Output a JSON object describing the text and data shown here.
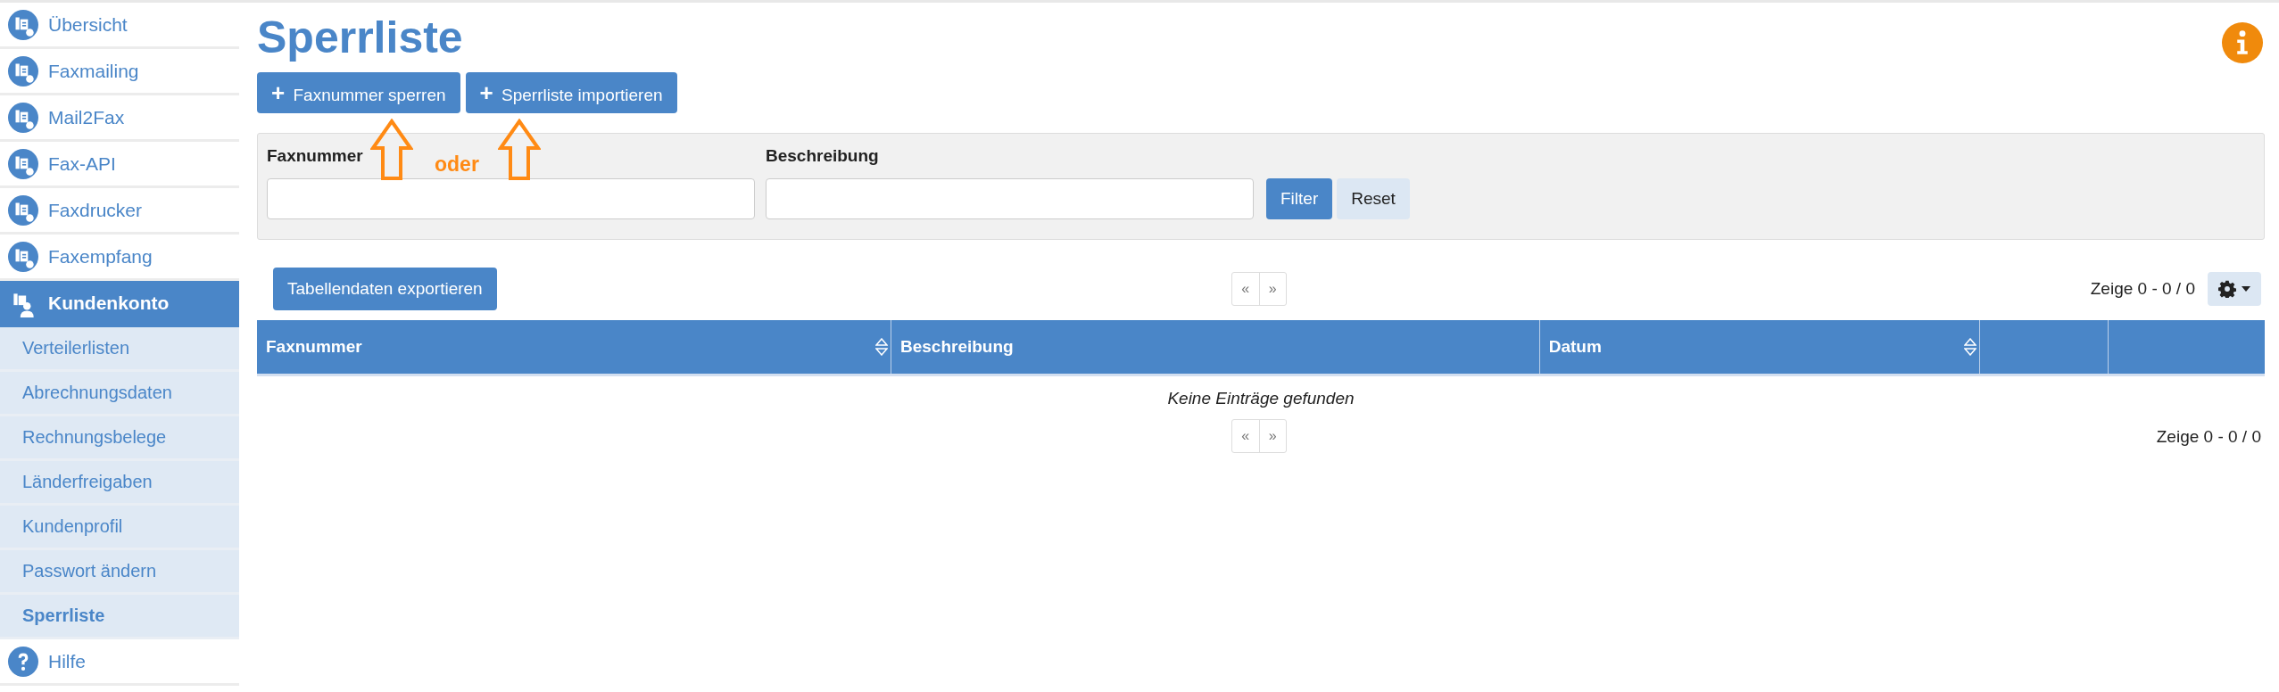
{
  "sidebar": {
    "items": [
      {
        "label": "Übersicht",
        "kind": "fax",
        "selected": false
      },
      {
        "label": "Faxmailing",
        "kind": "fax",
        "selected": false
      },
      {
        "label": "Mail2Fax",
        "kind": "fax",
        "selected": false
      },
      {
        "label": "Fax-API",
        "kind": "fax",
        "selected": false
      },
      {
        "label": "Faxdrucker",
        "kind": "fax",
        "selected": false
      },
      {
        "label": "Faxempfang",
        "kind": "fax",
        "selected": false
      },
      {
        "label": "Kundenkonto",
        "kind": "account",
        "selected": true,
        "expanded": true,
        "children": [
          {
            "label": "Verteilerlisten",
            "selected": false
          },
          {
            "label": "Abrechnungsdaten",
            "selected": false
          },
          {
            "label": "Rechnungsbelege",
            "selected": false
          },
          {
            "label": "Länderfreigaben",
            "selected": false
          },
          {
            "label": "Kundenprofil",
            "selected": false
          },
          {
            "label": "Passwort ändern",
            "selected": false
          },
          {
            "label": "Sperrliste",
            "selected": true
          }
        ]
      },
      {
        "label": "Hilfe",
        "kind": "help",
        "selected": false
      }
    ]
  },
  "page": {
    "title": "Sperrliste",
    "actions": [
      {
        "icon": "+",
        "label": "Faxnummer sperren"
      },
      {
        "icon": "+",
        "label": "Sperrliste importieren"
      }
    ],
    "annotation": {
      "text": "oder"
    },
    "filter": {
      "fields": [
        {
          "label": "Faxnummer"
        },
        {
          "label": "Beschreibung"
        }
      ],
      "buttons": [
        {
          "label": "Filter",
          "kind": "primary"
        },
        {
          "label": "Reset",
          "kind": "secondary"
        }
      ]
    },
    "export_button": "Tabellendaten exportieren",
    "pager_top": {
      "prev": "«",
      "next": "»",
      "range": "Zeige 0 - 0 / 0"
    },
    "table": {
      "columns": [
        {
          "label": "Faxnummer",
          "sortable": true
        },
        {
          "label": "Beschreibung",
          "sortable": false
        },
        {
          "label": "Datum",
          "sortable": true
        },
        {
          "sortable": false
        },
        {
          "sortable": false
        }
      ],
      "empty_text": "Keine Einträge gefunden"
    },
    "pager_bottom": {
      "prev": "«",
      "next": "»",
      "range": "Zeige 0 - 0 / 0"
    }
  }
}
